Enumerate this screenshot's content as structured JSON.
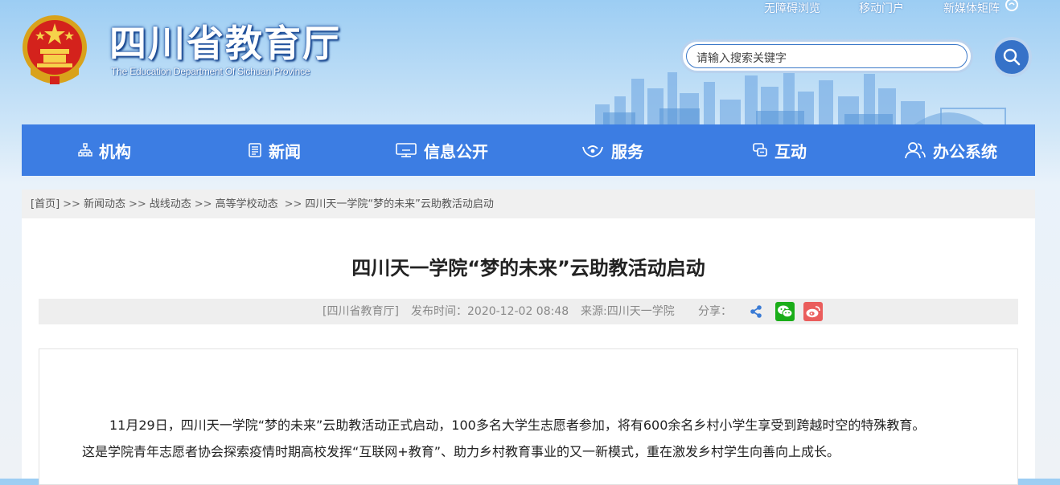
{
  "header": {
    "title": "四川省教育厅",
    "subtitle": "The Education Department Of Sichuan Province",
    "top_links": [
      "无障碍浏览",
      "移动门户",
      "新媒体矩阵"
    ],
    "search_placeholder": "请输入搜索关键字"
  },
  "nav": {
    "items": [
      {
        "label": "机构",
        "icon": "org-icon"
      },
      {
        "label": "新闻",
        "icon": "news-icon"
      },
      {
        "label": "信息公开",
        "icon": "monitor-icon"
      },
      {
        "label": "服务",
        "icon": "hands-icon"
      },
      {
        "label": "互动",
        "icon": "chat-icon"
      },
      {
        "label": "办公系统",
        "icon": "users-icon"
      }
    ]
  },
  "breadcrumb": {
    "items": [
      "[首页]",
      "新闻动态",
      "战线动态",
      "高等学校动态",
      "四川天一学院“梦的未来”云助教活动启动"
    ],
    "separator": ">>"
  },
  "article": {
    "title": "四川天一学院“梦的未来”云助教活动启动",
    "source": "[四川省教育厅]",
    "date": "发布时间：2020-12-02 08:48",
    "from": "来源:四川天一学院",
    "share_label": "分享：",
    "paragraphs": [
      "11月29日，四川天一学院“梦的未来”云助教活动正式启动，100多名大学生志愿者参加，将有600余名乡村小学生享受到跨越时空的特殊教育。",
      "这是学院青年志愿者协会探索疫情时期高校发挥“互联网+教育”、助力乡村教育事业的又一新模式，重在激发乡村学生向善向上成长。"
    ]
  },
  "colors": {
    "nav_bg": "#3c7de3",
    "search_button": "#3672c8",
    "wechat": "#1aad19",
    "weibo": "#ea5d5c"
  }
}
